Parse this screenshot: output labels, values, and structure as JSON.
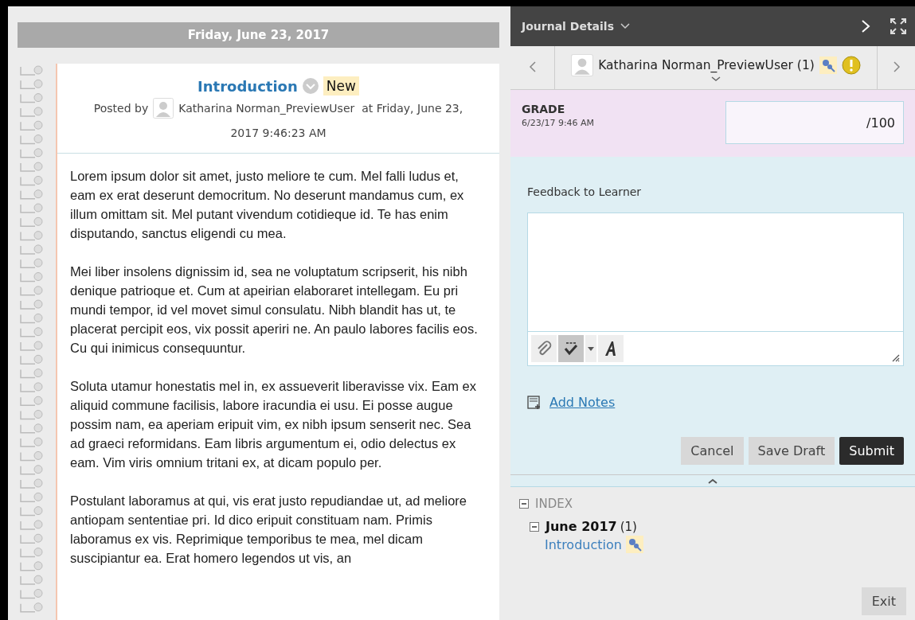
{
  "journal": {
    "date_header": "Friday, June 23, 2017",
    "entry": {
      "title": "Introduction",
      "badge": "New",
      "posted_by_label": "Posted by",
      "author": "Katharina Norman_PreviewUser",
      "posted_at": "at Friday, June 23, 2017 9:46:23 AM",
      "paragraphs": [
        "Lorem ipsum dolor sit amet, justo meliore te cum. Mel falli ludus et, eam ex erat deserunt democritum. No deserunt mandamus cum, ex illum omittam sit. Mel putant vivendum cotidieque id. Te has enim disputando, sanctus eligendi cu mea.",
        "Mei liber insolens dignissim id, sea ne voluptatum scripserit, his nibh denique patrioque et. Cum at apeirian elaboraret intellegam. Eu pri mundi tempor, id vel movet simul consulatu. Nibh blandit has ut, te placerat percipit eos, vix possit aperiri ne. An paulo labores facilis eos. Cu qui inimicus consequuntur.",
        "Soluta utamur honestatis mel in, ex assueverit liberavisse vix. Eam ex aliquid commune facilisis, labore iracundia ei usu. Ei posse augue possim nam, ea aperiam eripuit vim, ex nibh ipsum senserit nec. Sea ad graeci reformidans. Eam libris argumentum ei, odio delectus ex eam. Vim viris omnium tritani ex, at dicam populo per.",
        "Postulant laboramus at qui, vis erat justo repudiandae ut, ad meliore antiopam sententiae pri. Id dico eripuit constituam nam. Primis laboramus ex vis. Reprimique temporibus te mea, mel dicam suscipiantur ea. Erat homero legendos ut vis, an"
      ]
    }
  },
  "details": {
    "title": "Journal Details",
    "user": {
      "name": "Katharina Norman_PreviewUser (1)"
    },
    "grade": {
      "label": "GRADE",
      "timestamp": "6/23/17 9:46 AM",
      "out_of": "/100"
    },
    "feedback": {
      "label": "Feedback to Learner",
      "spellcheck_on": true
    },
    "add_notes": "Add Notes",
    "buttons": [
      {
        "label": "Cancel",
        "kind": "secondary"
      },
      {
        "label": "Save Draft",
        "kind": "secondary"
      },
      {
        "label": "Submit",
        "kind": "primary"
      }
    ],
    "index": {
      "title": "INDEX",
      "expanded": true,
      "groups": [
        {
          "label": "June 2017",
          "count": "(1)",
          "expanded": true,
          "children": [
            {
              "label": "Introduction"
            }
          ]
        }
      ]
    },
    "exit": "Exit"
  }
}
